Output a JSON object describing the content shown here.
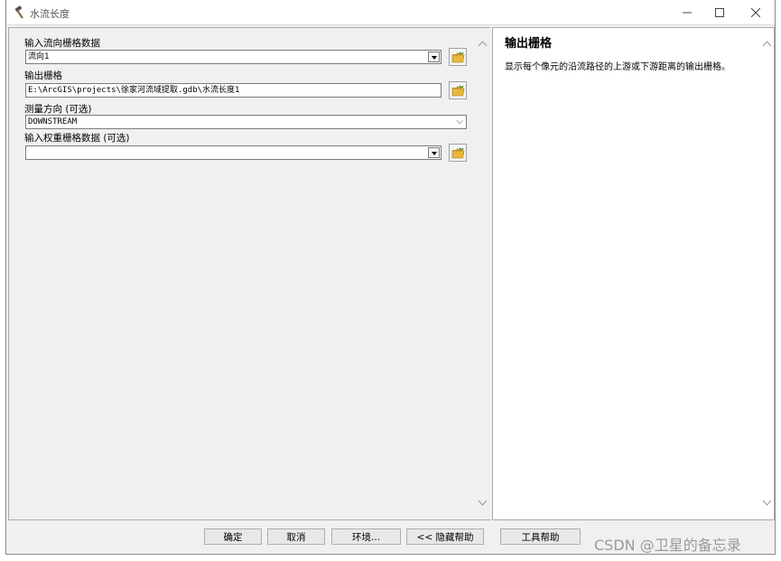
{
  "window": {
    "title": "水流长度",
    "icon": "hammer-icon"
  },
  "form": {
    "fields": [
      {
        "label": "输入流向栅格数据",
        "value": "流向1"
      },
      {
        "label": "输出栅格",
        "value": "E:\\ArcGIS\\projects\\徐家河流域提取.gdb\\水流长度1"
      },
      {
        "label": "测量方向 (可选)",
        "value": "DOWNSTREAM"
      },
      {
        "label": "输入权重栅格数据 (可选)",
        "value": ""
      }
    ]
  },
  "help": {
    "title": "输出栅格",
    "body": "显示每个像元的沿流路径的上游或下游距离的输出栅格。"
  },
  "buttons": {
    "ok": "确定",
    "cancel": "取消",
    "env": "环境...",
    "hide_help": "<< 隐藏帮助",
    "tool_help": "工具帮助"
  },
  "watermark": "CSDN @卫星的备忘录",
  "colors": {
    "window_bg": "#f0f0f0",
    "folder_yellow": "#e8b83a"
  }
}
